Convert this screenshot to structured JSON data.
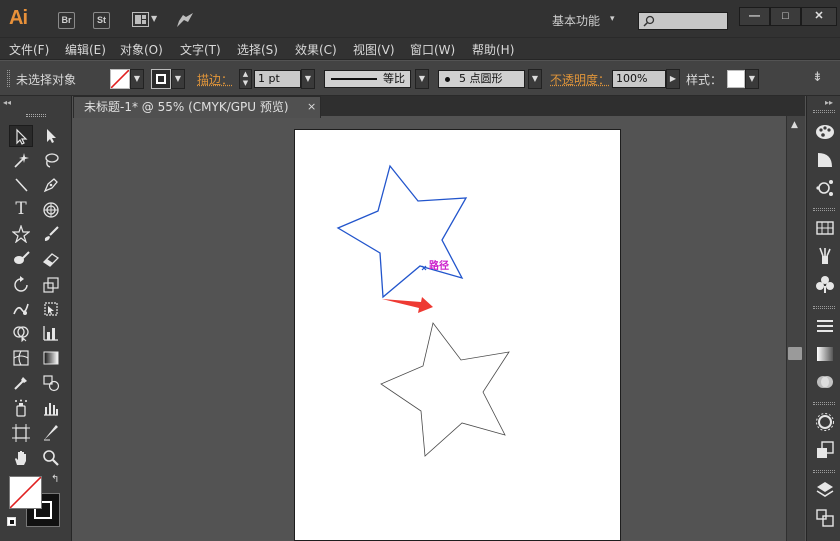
{
  "app": {
    "logo": "Ai",
    "br_label": "Br",
    "st_label": "St",
    "workspace": "基本功能"
  },
  "window_buttons": {
    "minimize": "—",
    "maximize": "□",
    "close": "✕"
  },
  "menu": [
    "文件(F)",
    "编辑(E)",
    "对象(O)",
    "文字(T)",
    "选择(S)",
    "效果(C)",
    "视图(V)",
    "窗口(W)",
    "帮助(H)"
  ],
  "control": {
    "selection_label": "未选择对象",
    "stroke_label": "描边：",
    "stroke_weight": "1 pt",
    "profile_label": "等比",
    "brush_label": "5 点圆形",
    "opacity_label": "不透明度：",
    "opacity_value": "100%",
    "style_label": "样式："
  },
  "document": {
    "tab_title": "未标题-1* @ 55% (CMYK/GPU 预览)",
    "close": "×"
  },
  "canvas": {
    "path_label": "路径",
    "selected_stroke_color": "#2255cc",
    "arrow_color": "#ee3a33",
    "label_color": "#cc22cc"
  },
  "colors": {
    "accent_orange": "#e0953a",
    "panel_dark": "#3c3c3c",
    "canvas_bg": "#535353"
  },
  "icons": {
    "tools": [
      "selection-icon",
      "direct-selection-icon",
      "magic-wand-icon",
      "lasso-icon",
      "line-icon",
      "pen-icon",
      "type-icon",
      "spiral-icon",
      "star-icon",
      "paintbrush-icon",
      "blob-brush-icon",
      "eraser-icon",
      "rotate-icon",
      "scale-icon",
      "warp-icon",
      "free-transform-icon",
      "shape-builder-icon",
      "graph-icon",
      "mesh-icon",
      "gradient-icon",
      "eyedropper-icon",
      "blend-icon",
      "symbol-sprayer-icon",
      "column-graph-icon",
      "artboard-icon",
      "slice-icon",
      "hand-icon",
      "zoom-icon"
    ],
    "panels": [
      "color-palette-icon",
      "color-guide-icon",
      "transform-links-icon",
      "swatches-icon",
      "brushes-icon",
      "symbols-icon",
      "stroke-icon",
      "gradient-panel-icon",
      "transparency-icon",
      "appearance-icon",
      "graphic-styles-icon",
      "layers-icon",
      "artboards-panel-icon"
    ]
  }
}
